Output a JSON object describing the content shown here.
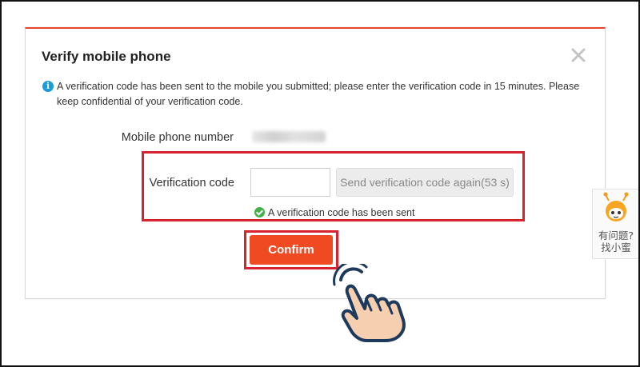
{
  "dialog": {
    "title": "Verify mobile phone",
    "notice": "A verification code has been sent to the mobile you submitted; please enter the verification code in 15 minutes. Please keep confidential of your verification code.",
    "phone_label": "Mobile phone number",
    "code_label": "Verification code",
    "code_value": "",
    "send_again_label": "Send verification code again(53 s)",
    "sent_message": "A verification code has been sent",
    "confirm_label": "Confirm"
  },
  "helper": {
    "line1": "有问题?",
    "line2": "找小蜜"
  },
  "colors": {
    "accent": "#f04a23",
    "highlight": "#d72230",
    "info": "#1a9be0",
    "success": "#43b04a"
  },
  "icons": [
    "info-icon",
    "close-icon",
    "check-icon",
    "helper-mascot-icon",
    "pointer-hand-icon"
  ]
}
